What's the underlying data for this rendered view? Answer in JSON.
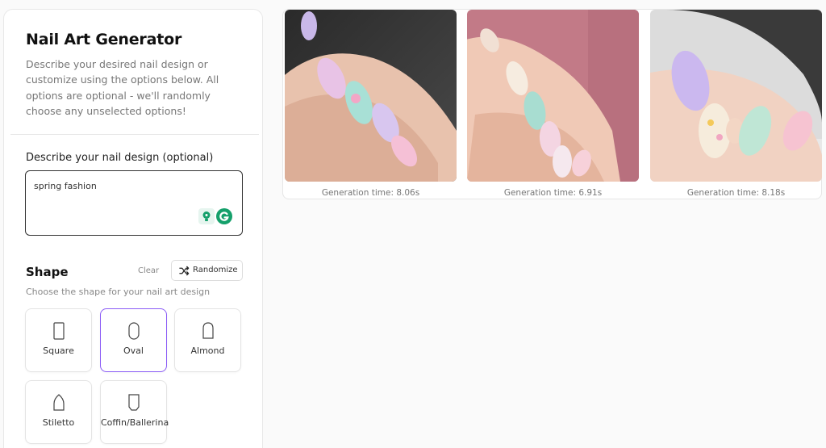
{
  "panel": {
    "title": "Nail Art Generator",
    "description": "Describe your desired nail design or customize using the options below. All options are optional - we'll randomly choose any unselected options!",
    "design_label": "Describe your nail design (optional)",
    "design_value": "spring fashion"
  },
  "shape": {
    "title": "Shape",
    "clear_label": "Clear",
    "randomize_label": "Randomize",
    "subtitle": "Choose the shape for your nail art design",
    "selected": "Oval",
    "options": [
      "Square",
      "Oval",
      "Almond",
      "Stiletto",
      "Coffin/Ballerina"
    ]
  },
  "results": [
    {
      "time": "Generation time: 8.06s"
    },
    {
      "time": "Generation time: 6.91s"
    },
    {
      "time": "Generation time: 8.18s"
    }
  ],
  "colors": {
    "accent": "#8b5cf6"
  }
}
